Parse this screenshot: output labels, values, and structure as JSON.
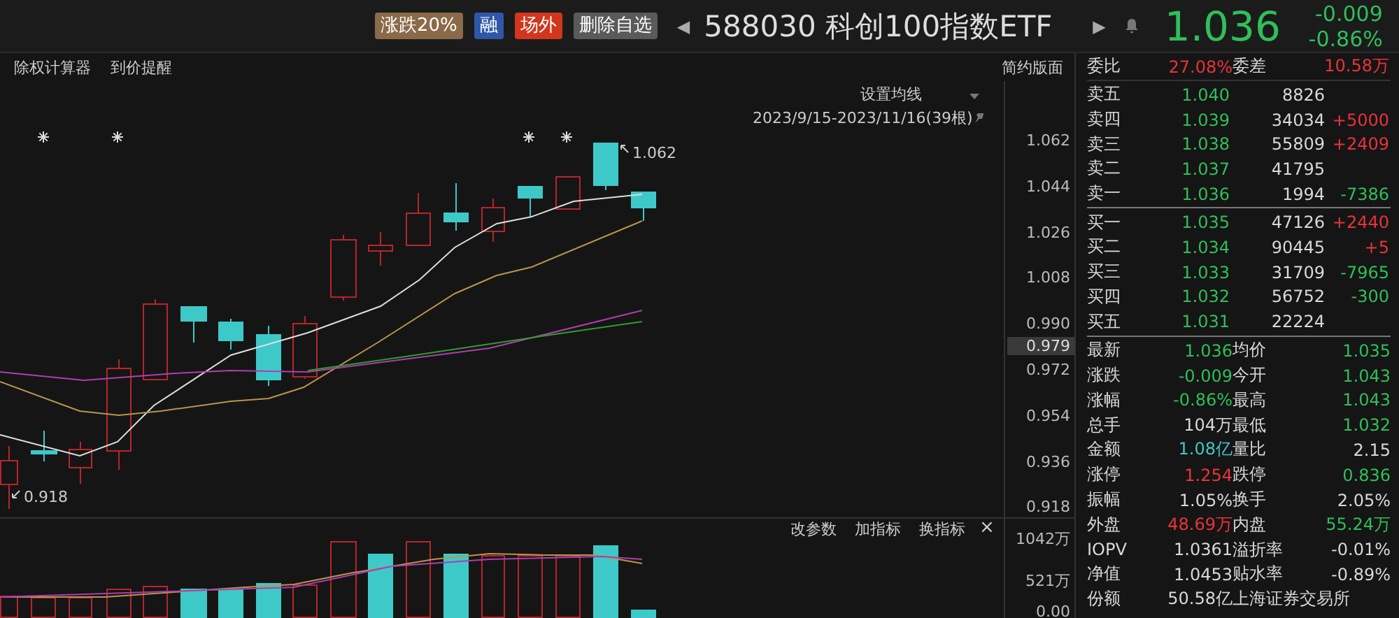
{
  "top_bar": {
    "tags": [
      {
        "label": "涨跌20%",
        "color": "#8a6a48"
      },
      {
        "label": "融",
        "color": "#2f57a8"
      },
      {
        "label": "场外",
        "color": "#d2361c"
      },
      {
        "label": "删除自选",
        "color": "#5a5a5a"
      }
    ],
    "prev_button": "◀",
    "title": "588030 科创100指数ETF",
    "next_button": "▶",
    "price": "1.036",
    "change": "-0.009",
    "change_pct": "-0.86%"
  },
  "chart_toolbar": {
    "links": [
      "除权计算器",
      "到价提醒"
    ],
    "layout_button": "简约版面",
    "ma_setting": "设置均线",
    "date_range": "2023/9/15-2023/11/16(39根)"
  },
  "price_chart": {
    "y_axis_labels": [
      "1.062",
      "1.044",
      "1.026",
      "1.008",
      "0.990",
      "0.972",
      "0.954",
      "0.936",
      "0.918"
    ],
    "current_price_tag": "0.979",
    "high_label": "1.062",
    "low_label": "0.918"
  },
  "volume_panel": {
    "actions": [
      "改参数",
      "加指标",
      "换指标"
    ],
    "close": "×",
    "y_axis_labels": [
      "1042万",
      "521万",
      "0.00"
    ]
  },
  "order_book": {
    "ratio": {
      "label": "委比",
      "value": "27.08%"
    },
    "diff": {
      "label": "委差",
      "value": "10.58万"
    },
    "asks": [
      {
        "label": "卖五",
        "price": "1.040",
        "volume": "8826"
      },
      {
        "label": "卖四",
        "price": "1.039",
        "volume": "34034",
        "change": "+5000",
        "color": "#e8343a"
      },
      {
        "label": "卖三",
        "price": "1.038",
        "volume": "55809",
        "change": "+2409",
        "color": "#e8343a"
      },
      {
        "label": "卖二",
        "price": "1.037",
        "volume": "41795"
      },
      {
        "label": "卖一",
        "price": "1.036",
        "volume": "1994",
        "change": "-7386",
        "color": "#2fbf5a"
      }
    ],
    "bids": [
      {
        "label": "买一",
        "price": "1.035",
        "volume": "47126",
        "change": "+2440",
        "color": "#e8343a"
      },
      {
        "label": "买二",
        "price": "1.034",
        "volume": "90445",
        "change": "+5",
        "color": "#e8343a"
      },
      {
        "label": "买三",
        "price": "1.033",
        "volume": "31709",
        "change": "-7965",
        "color": "#2fbf5a"
      },
      {
        "label": "买四",
        "price": "1.032",
        "volume": "56752",
        "change": "-300",
        "color": "#2fbf5a"
      },
      {
        "label": "买五",
        "price": "1.031",
        "volume": "22224"
      }
    ]
  },
  "stats": [
    {
      "left": {
        "label": "最新",
        "value": "1.036",
        "color": "#2fbf5a"
      },
      "right": {
        "label": "均价",
        "value": "1.035",
        "color": "#2fbf5a"
      }
    },
    {
      "left": {
        "label": "涨跌",
        "value": "-0.009",
        "color": "#2fbf5a"
      },
      "right": {
        "label": "今开",
        "value": "1.043",
        "color": "#2fbf5a"
      }
    },
    {
      "left": {
        "label": "涨幅",
        "value": "-0.86%",
        "color": "#2fbf5a"
      },
      "right": {
        "label": "最高",
        "value": "1.043",
        "color": "#2fbf5a"
      }
    },
    {
      "left": {
        "label": "总手",
        "value": "104万",
        "color": "#d8d8d8"
      },
      "right": {
        "label": "最低",
        "value": "1.032",
        "color": "#2fbf5a"
      }
    },
    {
      "left": {
        "label": "金额",
        "value": "1.08亿",
        "color": "#3ec7c7"
      },
      "right": {
        "label": "量比",
        "value": "2.15",
        "color": "#d8d8d8"
      }
    },
    {
      "left": {
        "label": "涨停",
        "value": "1.254",
        "color": "#e8343a"
      },
      "right": {
        "label": "跌停",
        "value": "0.836",
        "color": "#2fbf5a"
      }
    },
    {
      "left": {
        "label": "振幅",
        "value": "1.05%",
        "color": "#d8d8d8"
      },
      "right": {
        "label": "换手",
        "value": "2.05%",
        "color": "#d8d8d8"
      }
    },
    {
      "left": {
        "label": "外盘",
        "value": "48.69万",
        "color": "#e8343a"
      },
      "right": {
        "label": "内盘",
        "value": "55.24万",
        "color": "#2fbf5a"
      }
    },
    {
      "left": {
        "label": "IOPV",
        "value": "1.0361",
        "color": "#d8d8d8"
      },
      "right": {
        "label": "溢折率",
        "value": "-0.01%",
        "color": "#d8d8d8"
      }
    },
    {
      "left": {
        "label": "净值",
        "value": "1.0453",
        "color": "#d8d8d8"
      },
      "right": {
        "label": "贴水率",
        "value": "-0.89%",
        "color": "#d8d8d8"
      }
    },
    {
      "left": {
        "label": "份额",
        "value": "50.58亿",
        "color": "#d8d8d8"
      },
      "right": {
        "label": "上海证券交易所"
      }
    }
  ]
}
